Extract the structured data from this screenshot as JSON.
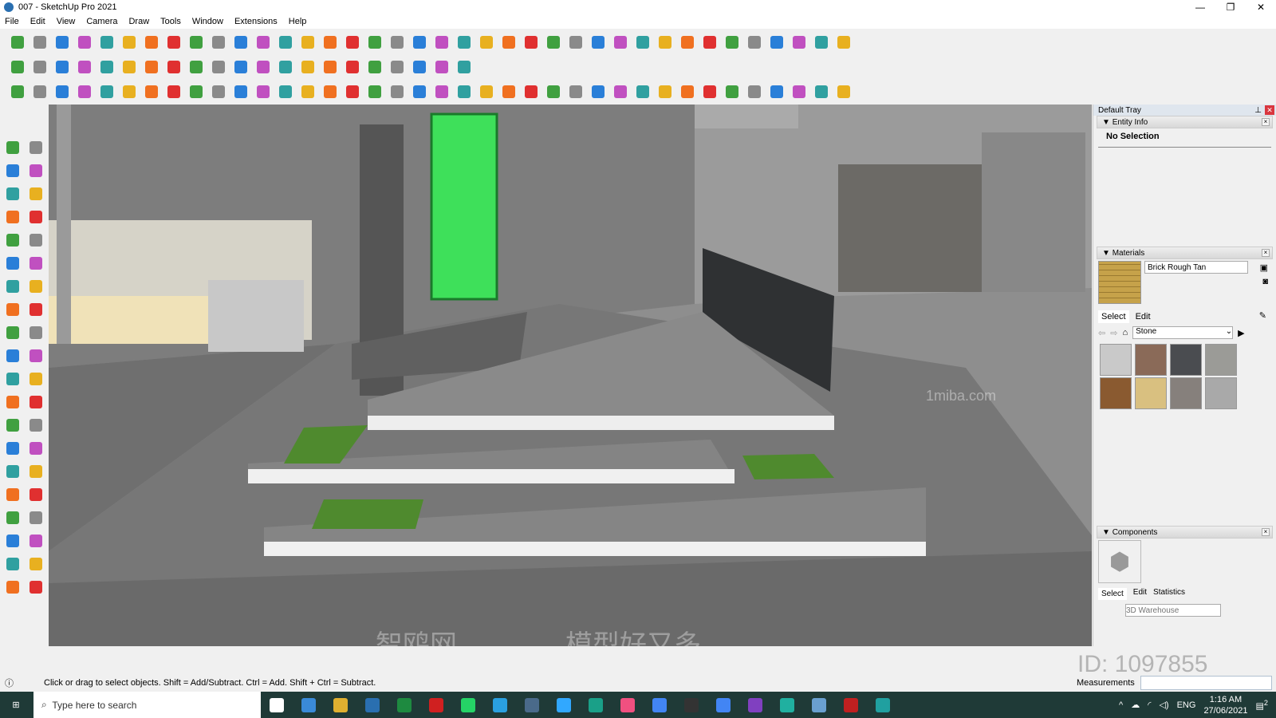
{
  "window": {
    "title": "007 - SketchUp Pro 2021",
    "min": "—",
    "max": "❐",
    "close": "✕"
  },
  "menu": [
    "File",
    "Edit",
    "View",
    "Camera",
    "Draw",
    "Tools",
    "Window",
    "Extensions",
    "Help"
  ],
  "colors": {
    "accent": "#2a6fb0",
    "taskbar": "#1f3a37",
    "viewport": "#8c8c8c",
    "green_panel": "#3ee05a"
  },
  "tray": {
    "title": "Default Tray",
    "entity_info": {
      "title": "Entity Info",
      "value": "No Selection"
    },
    "materials": {
      "title": "Materials",
      "name": "Brick Rough Tan",
      "tabs": [
        "Select",
        "Edit"
      ],
      "library": "Stone",
      "swatches": [
        "#c9c9c9",
        "#8a6a58",
        "#4a4c50",
        "#9b9b97",
        "#8a5a30",
        "#d9c080",
        "#86807c",
        "#a9a9a9"
      ]
    },
    "components": {
      "title": "Components",
      "tabs": [
        "Select",
        "Edit",
        "Statistics"
      ],
      "search_placeholder": "3D Warehouse"
    }
  },
  "status": {
    "hint": "Click or drag to select objects. Shift = Add/Subtract. Ctrl = Add. Shift + Ctrl = Subtract.",
    "measurements_label": "Measurements"
  },
  "taskbar": {
    "search_placeholder": "Type here to search",
    "lang": "ENG",
    "time": "1:16 AM",
    "date": "27/06/2021",
    "notifications": "2"
  },
  "watermarks": [
    "智鸥网————模型好又多————",
    "1miba.com",
    "ID: 1097855"
  ]
}
